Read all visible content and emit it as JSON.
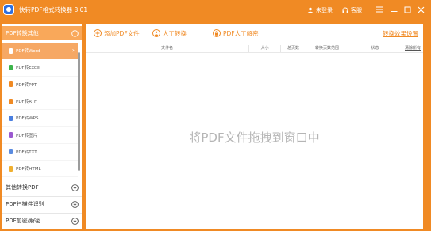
{
  "window": {
    "title": "快转PDF格式转换器 8.01",
    "login_label": "未登录",
    "help_label": "客服"
  },
  "sidebar": {
    "active_section": "PDF转换其他",
    "items": [
      {
        "label": "PDF转Word",
        "icon_color": "#ffffff"
      },
      {
        "label": "PDF转Excel",
        "icon_color": "#3cb44b"
      },
      {
        "label": "PDF转PPT",
        "icon_color": "#f08a24"
      },
      {
        "label": "PDF转RTF",
        "icon_color": "#f08a24"
      },
      {
        "label": "PDF转WPS",
        "icon_color": "#4a7fe0"
      },
      {
        "label": "PDF转图片",
        "icon_color": "#9b59d0"
      },
      {
        "label": "PDF转TXT",
        "icon_color": "#5a8be0"
      },
      {
        "label": "PDF转HTML",
        "icon_color": "#f0b030"
      }
    ],
    "sections": [
      "其他转换PDF",
      "PDF扫描件识别",
      "PDF加密/解密"
    ]
  },
  "toolbar": {
    "add_file": "添加PDF文件",
    "manual_convert": "人工转换",
    "manual_decrypt": "PDF人工解密",
    "settings_link": "转换效果设置"
  },
  "table": {
    "col_filename": "文件名",
    "col_size": "大小",
    "col_pages": "总页数",
    "col_range": "转换页数范围",
    "col_status": "状态",
    "col_clear": "清除所有"
  },
  "drop_hint": "将PDF文件拖拽到窗口中",
  "colors": {
    "brand": "#f08a24",
    "active_item": "#f6a864"
  }
}
